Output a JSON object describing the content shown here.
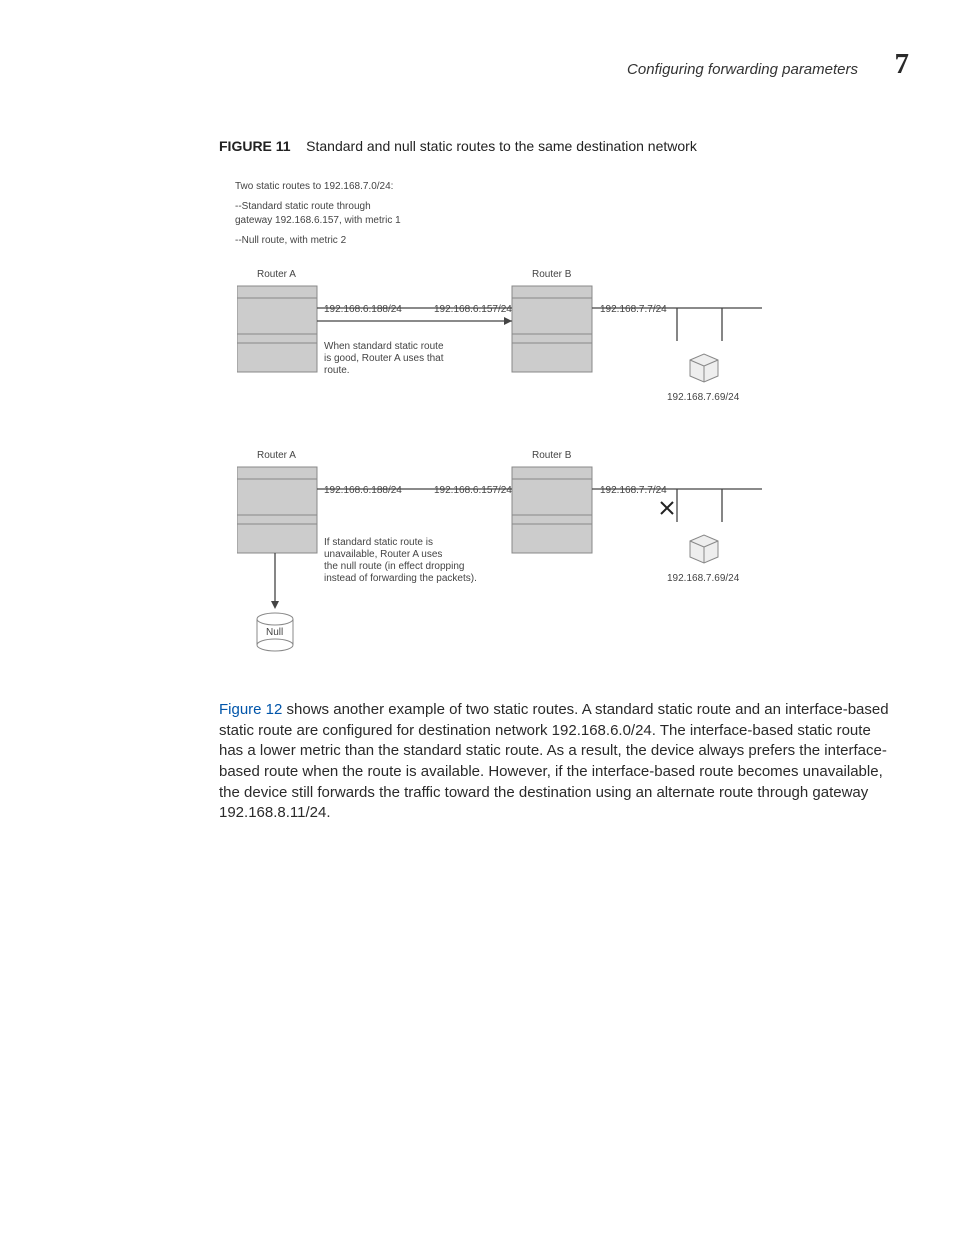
{
  "header": {
    "section": "Configuring forwarding parameters",
    "chapter": "7"
  },
  "figcap": {
    "label": "FIGURE 11",
    "title": "Standard and null static routes to the same destination network"
  },
  "pre": {
    "l1": "Two static routes to 192.168.7.0/24:",
    "l2": "--Standard static route through",
    "l3": "gateway 192.168.6.157, with metric 1",
    "l4": "--Null route, with metric 2"
  },
  "d1": {
    "routerA": "Router A",
    "routerB": "Router B",
    "ipA": "192.168.6.188/24",
    "ipB": "192.168.6.157/24",
    "ipC": "192.168.7.7/24",
    "ipD": "192.168.7.69/24",
    "note1": "When standard static route",
    "note2": "is good, Router A uses that",
    "note3": "route."
  },
  "d2": {
    "routerA": "Router A",
    "routerB": "Router B",
    "ipA": "192.168.6.188/24",
    "ipB": "192.168.6.157/24",
    "ipC": "192.168.7.7/24",
    "ipD": "192.168.7.69/24",
    "note1": "If standard static route is",
    "note2": "unavailable, Router A uses",
    "note3": "the null route (in effect dropping",
    "note4": "instead of forwarding the packets).",
    "null": "Null"
  },
  "para": {
    "link": "Figure 12",
    "text": " shows another example of two static routes. A standard static route and an interface-based static route are configured for destination network 192.168.6.0/24. The interface-based static route has a lower metric than the standard static route. As a result, the device always prefers the interface-based route when the route is available. However, if the interface-based route becomes unavailable, the device still forwards the traffic toward the destination using an alternate route through gateway 192.168.8.11/24."
  }
}
